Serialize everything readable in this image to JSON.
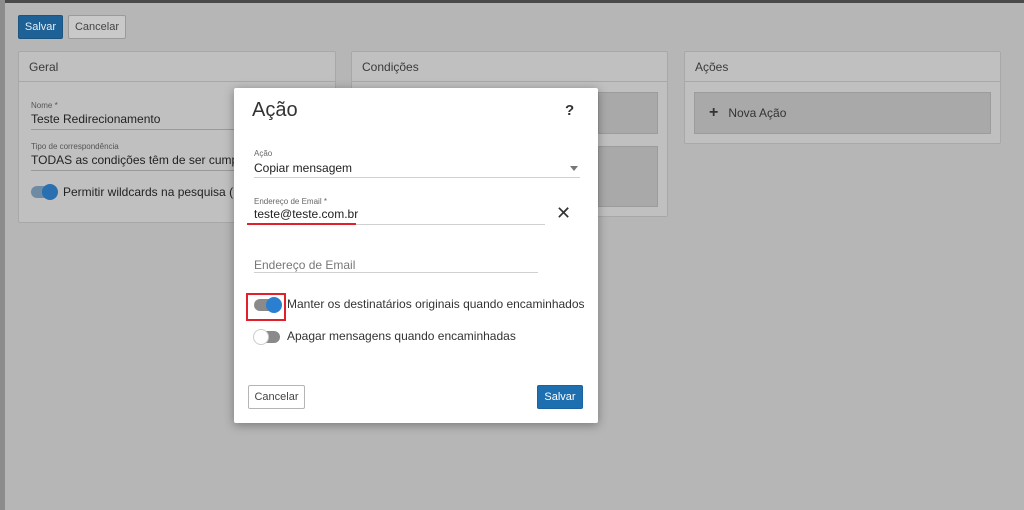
{
  "toolbar": {
    "save_label": "Salvar",
    "cancel_label": "Cancelar"
  },
  "panels": {
    "geral": {
      "title": "Geral",
      "name_label": "Nome *",
      "name_value": "Teste Redirecionamento",
      "match_label": "Tipo de correspondência",
      "match_value": "TODAS as condições têm de ser cumpridas",
      "wildcard_label": "Permitir wildcards na pesquisa ( * e"
    },
    "condicoes": {
      "title": "Condições"
    },
    "acoes": {
      "title": "Ações",
      "add_action_label": "Nova Ação",
      "add_icon": "+"
    }
  },
  "modal": {
    "title": "Ação",
    "help_icon": "?",
    "action_label": "Ação",
    "action_value": "Copiar mensagem",
    "email_label": "Endereço de Email *",
    "email_value": "teste@teste.com.br",
    "clear_icon": "✕",
    "email2_placeholder": "Endereço de Email",
    "keep_recipients_label": "Manter os destinatários originais quando encaminhados",
    "keep_recipients_on": true,
    "delete_messages_label": "Apagar mensagens quando encaminhadas",
    "delete_messages_on": false,
    "cancel_label": "Cancelar",
    "save_label": "Salvar"
  },
  "colors": {
    "accent": "#1e6fb0",
    "highlight_red": "#e0202a",
    "toggle_on": "#2b7fd0"
  }
}
